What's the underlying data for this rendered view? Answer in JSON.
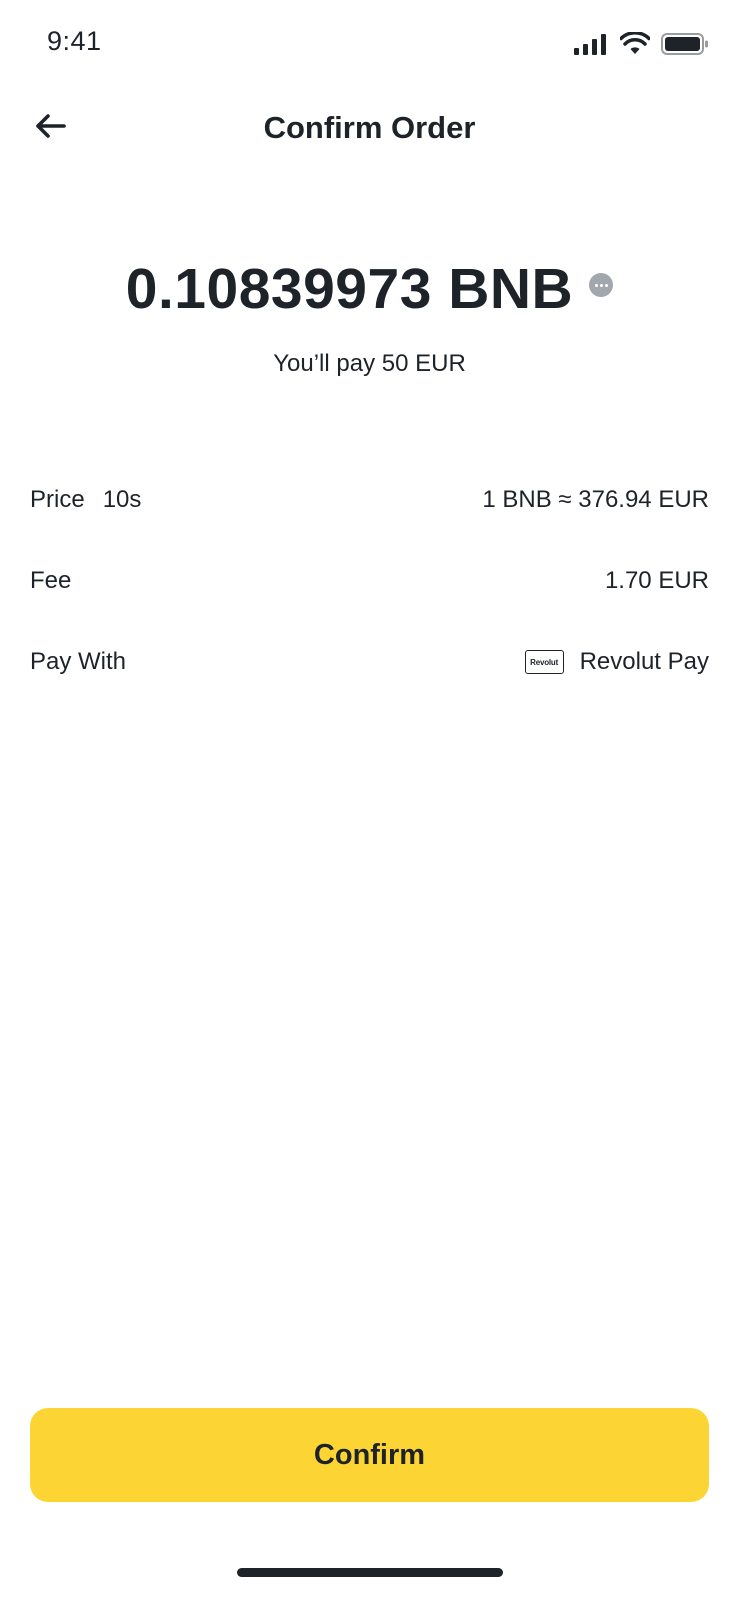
{
  "status_bar": {
    "time": "9:41",
    "icons": [
      "cellular-signal-icon",
      "wifi-icon",
      "battery-icon"
    ]
  },
  "header": {
    "title": "Confirm Order",
    "back_icon": "arrow-left-icon"
  },
  "order": {
    "amount": "0.10839973 BNB",
    "info_icon": "more-dots-icon",
    "pay_prefix": "You’ll pay",
    "pay_amount": "50",
    "pay_currency": "EUR"
  },
  "details": {
    "price": {
      "label": "Price",
      "timer": "10s",
      "value": "1 BNB ≈ 376.94 EUR"
    },
    "fee": {
      "label": "Fee",
      "value": "1.70 EUR"
    },
    "pay_with": {
      "label": "Pay With",
      "logo_text": "Revolut",
      "value": "Revolut Pay"
    }
  },
  "actions": {
    "confirm_label": "Confirm"
  },
  "colors": {
    "text": "#1e2329",
    "accent": "#fcd535",
    "icon_gray": "#a2a7ae"
  }
}
